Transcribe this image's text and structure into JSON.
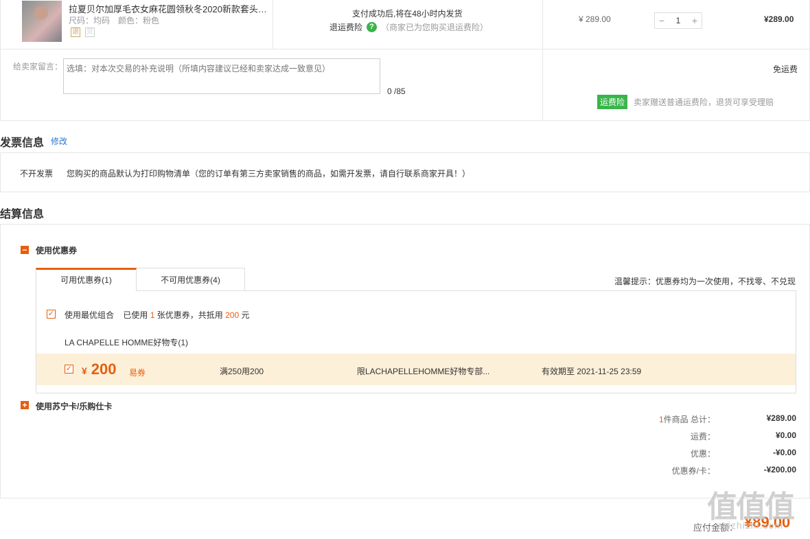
{
  "product": {
    "name": "拉夏贝尔加厚毛衣女麻花圆领秋冬2020新款套头慵...",
    "size": "尺码：均码",
    "color": "颜色：粉色",
    "tag1": "退",
    "tag2": "贝",
    "ship_note": "支付成功后,将在48小时内发货",
    "insurance_label": "退运费险",
    "insurance_note": "（商家已为您购买退运费险）",
    "unit_price": "¥ 289.00",
    "quantity": "1",
    "line_total": "¥289.00"
  },
  "message": {
    "label": "给卖家留言：",
    "placeholder": "选填：对本次交易的补充说明（所填内容建议已经和卖家达成一致意见）",
    "count": "0 /85",
    "free_shipping": "免运费",
    "insure_badge": "运费险",
    "insure_desc": "卖家赠送普通运费险，退货可享受理赔"
  },
  "invoice": {
    "title": "发票信息",
    "edit": "修改",
    "type": "不开发票",
    "desc": "您购买的商品默认为打印购物清单（您的订单有第三方卖家销售的商品，如需开发票，请自行联系商家开具！）"
  },
  "settlement": {
    "title": "结算信息",
    "use_coupon": "使用优惠券",
    "tab_available": "可用优惠券(1)",
    "tab_unavailable": "不可用优惠券(4)",
    "tip": "温馨提示：优惠券均为一次使用，不找零、不兑现",
    "best_combo": "使用最优组合",
    "used_prefix": "已使用",
    "used_count": "1",
    "used_mid": "张优惠券，共抵用",
    "used_amount": "200",
    "used_suffix": "元",
    "store": "LA CHAPELLE HOMME好物专(1)",
    "coupon": {
      "currency": "¥",
      "amount": "200",
      "type": "易券",
      "rule": "满250用200",
      "scope": "限LACHAPELLEHOMME好物专部...",
      "valid": "有效期至 2021-11-25 23:59"
    },
    "use_card": "使用苏宁卡/乐购仕卡"
  },
  "summary": {
    "count": "1",
    "total_label": "件商品 总计：",
    "total": "¥289.00",
    "freight_label": "运费：",
    "freight": "¥0.00",
    "discount_label": "优惠：",
    "discount": "-¥0.00",
    "coupon_label": "优惠券/卡：",
    "coupon_value": "-¥200.00",
    "pay_label": "应付金额：",
    "pay_amount": "¥89.00"
  },
  "watermark": {
    "big": "值值值",
    "small": "zhizhizhi.com"
  },
  "colors": {
    "accent": "#e65f0e",
    "green": "#3ab54a",
    "link": "#2d77c8",
    "coupon_bg": "#fdf0d9"
  }
}
